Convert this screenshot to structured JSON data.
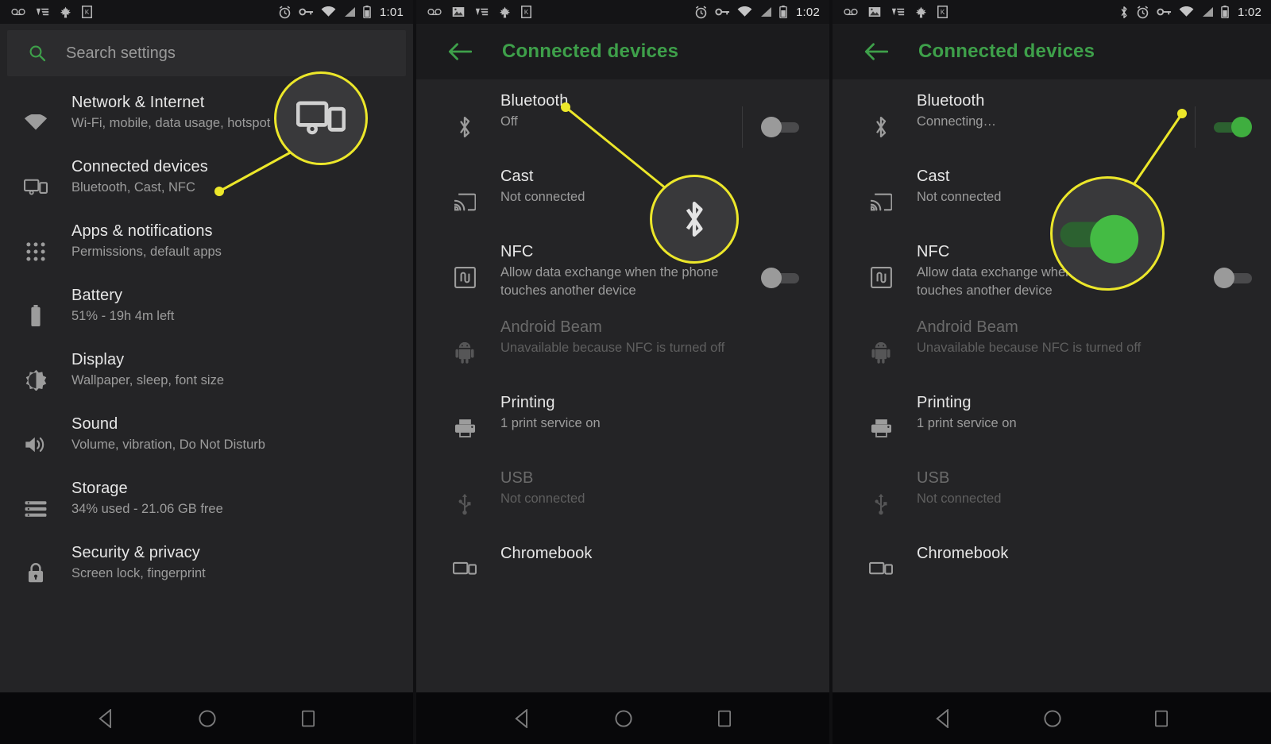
{
  "meta": {
    "accent_green": "#3ea04a",
    "toggle_on_color": "#3fae3f",
    "callout_yellow": "#ece72a",
    "panel_bg": "#242426",
    "appbar_bg": "#1b1b1d",
    "statusbar_bg": "#141416"
  },
  "panel1": {
    "statusbar": {
      "time": "1:01",
      "left_icons": [
        "voicemail-icon",
        "vf-app-icon",
        "maple-leaf-icon",
        "kindle-icon"
      ],
      "right_icons": [
        "alarm-icon",
        "vpn-key-icon",
        "wifi-icon",
        "cell-signal-icon",
        "battery-icon"
      ]
    },
    "search": {
      "icon": "search-icon",
      "placeholder": "Search settings"
    },
    "items": [
      {
        "icon": "wifi-icon",
        "title": "Network & Internet",
        "subtitle": "Wi-Fi, mobile, data usage, hotspot",
        "dim": false
      },
      {
        "icon": "devices-icon",
        "title": "Connected devices",
        "subtitle": "Bluetooth, Cast, NFC",
        "dim": false
      },
      {
        "icon": "apps-grid-icon",
        "title": "Apps & notifications",
        "subtitle": "Permissions, default apps",
        "dim": false
      },
      {
        "icon": "battery-icon",
        "title": "Battery",
        "subtitle": "51% - 19h 4m left",
        "dim": false
      },
      {
        "icon": "brightness-icon",
        "title": "Display",
        "subtitle": "Wallpaper, sleep, font size",
        "dim": false
      },
      {
        "icon": "volume-icon",
        "title": "Sound",
        "subtitle": "Volume, vibration, Do Not Disturb",
        "dim": false
      },
      {
        "icon": "storage-icon",
        "title": "Storage",
        "subtitle": "34% used - 21.06 GB free",
        "dim": false
      },
      {
        "icon": "lock-icon",
        "title": "Security & privacy",
        "subtitle": "Screen lock, fingerprint",
        "dim": false
      }
    ],
    "callout": {
      "icon": "devices-icon",
      "target": "connected-devices-row"
    }
  },
  "panel2": {
    "statusbar": {
      "time": "1:02",
      "left_icons": [
        "voicemail-icon",
        "gallery-icon",
        "vf-app-icon",
        "maple-leaf-icon",
        "kindle-icon"
      ],
      "right_icons": [
        "alarm-icon",
        "vpn-key-icon",
        "wifi-icon",
        "cell-signal-icon",
        "battery-icon"
      ]
    },
    "appbar": {
      "back_icon": "arrow-back-icon",
      "title": "Connected devices"
    },
    "items": [
      {
        "icon": "bluetooth-icon",
        "title": "Bluetooth",
        "subtitle": "Off",
        "dim": false,
        "toggle": "off"
      },
      {
        "icon": "cast-icon",
        "title": "Cast",
        "subtitle": "Not connected",
        "dim": false,
        "toggle": null
      },
      {
        "icon": "nfc-icon",
        "title": "NFC",
        "subtitle": "Allow data exchange when the phone\ntouches another device",
        "dim": false,
        "toggle": "off"
      },
      {
        "icon": "android-icon",
        "title": "Android Beam",
        "subtitle": "Unavailable because NFC is turned off",
        "dim": true,
        "toggle": null
      },
      {
        "icon": "printer-icon",
        "title": "Printing",
        "subtitle": "1 print service on",
        "dim": false,
        "toggle": null
      },
      {
        "icon": "usb-icon",
        "title": "USB",
        "subtitle": "Not connected",
        "dim": true,
        "toggle": null
      },
      {
        "icon": "chromebook-icon",
        "title": "Chromebook",
        "subtitle": "",
        "dim": false,
        "toggle": null
      }
    ],
    "callout": {
      "icon": "bluetooth-icon",
      "target": "bluetooth-row"
    }
  },
  "panel3": {
    "statusbar": {
      "time": "1:02",
      "left_icons": [
        "voicemail-icon",
        "gallery-icon",
        "vf-app-icon",
        "maple-leaf-icon",
        "kindle-icon"
      ],
      "right_icons": [
        "bluetooth-icon",
        "alarm-icon",
        "vpn-key-icon",
        "wifi-icon",
        "cell-signal-icon",
        "battery-icon"
      ]
    },
    "appbar": {
      "back_icon": "arrow-back-icon",
      "title": "Connected devices"
    },
    "items": [
      {
        "icon": "bluetooth-icon",
        "title": "Bluetooth",
        "subtitle": "Connecting…",
        "dim": false,
        "toggle": "on"
      },
      {
        "icon": "cast-icon",
        "title": "Cast",
        "subtitle": "Not connected",
        "dim": false,
        "toggle": null
      },
      {
        "icon": "nfc-icon",
        "title": "NFC",
        "subtitle": "Allow data exchange when the phone\ntouches another device",
        "dim": false,
        "toggle": "off"
      },
      {
        "icon": "android-icon",
        "title": "Android Beam",
        "subtitle": "Unavailable because NFC is turned off",
        "dim": true,
        "toggle": null
      },
      {
        "icon": "printer-icon",
        "title": "Printing",
        "subtitle": "1 print service on",
        "dim": false,
        "toggle": null
      },
      {
        "icon": "usb-icon",
        "title": "USB",
        "subtitle": "Not connected",
        "dim": true,
        "toggle": null
      },
      {
        "icon": "chromebook-icon",
        "title": "Chromebook",
        "subtitle": "",
        "dim": false,
        "toggle": null
      }
    ],
    "callout": {
      "icon": "toggle-on-switch",
      "target": "bluetooth-toggle"
    }
  },
  "navbar": {
    "back_label": "back-button",
    "home_label": "home-button",
    "recents_label": "recents-button"
  }
}
